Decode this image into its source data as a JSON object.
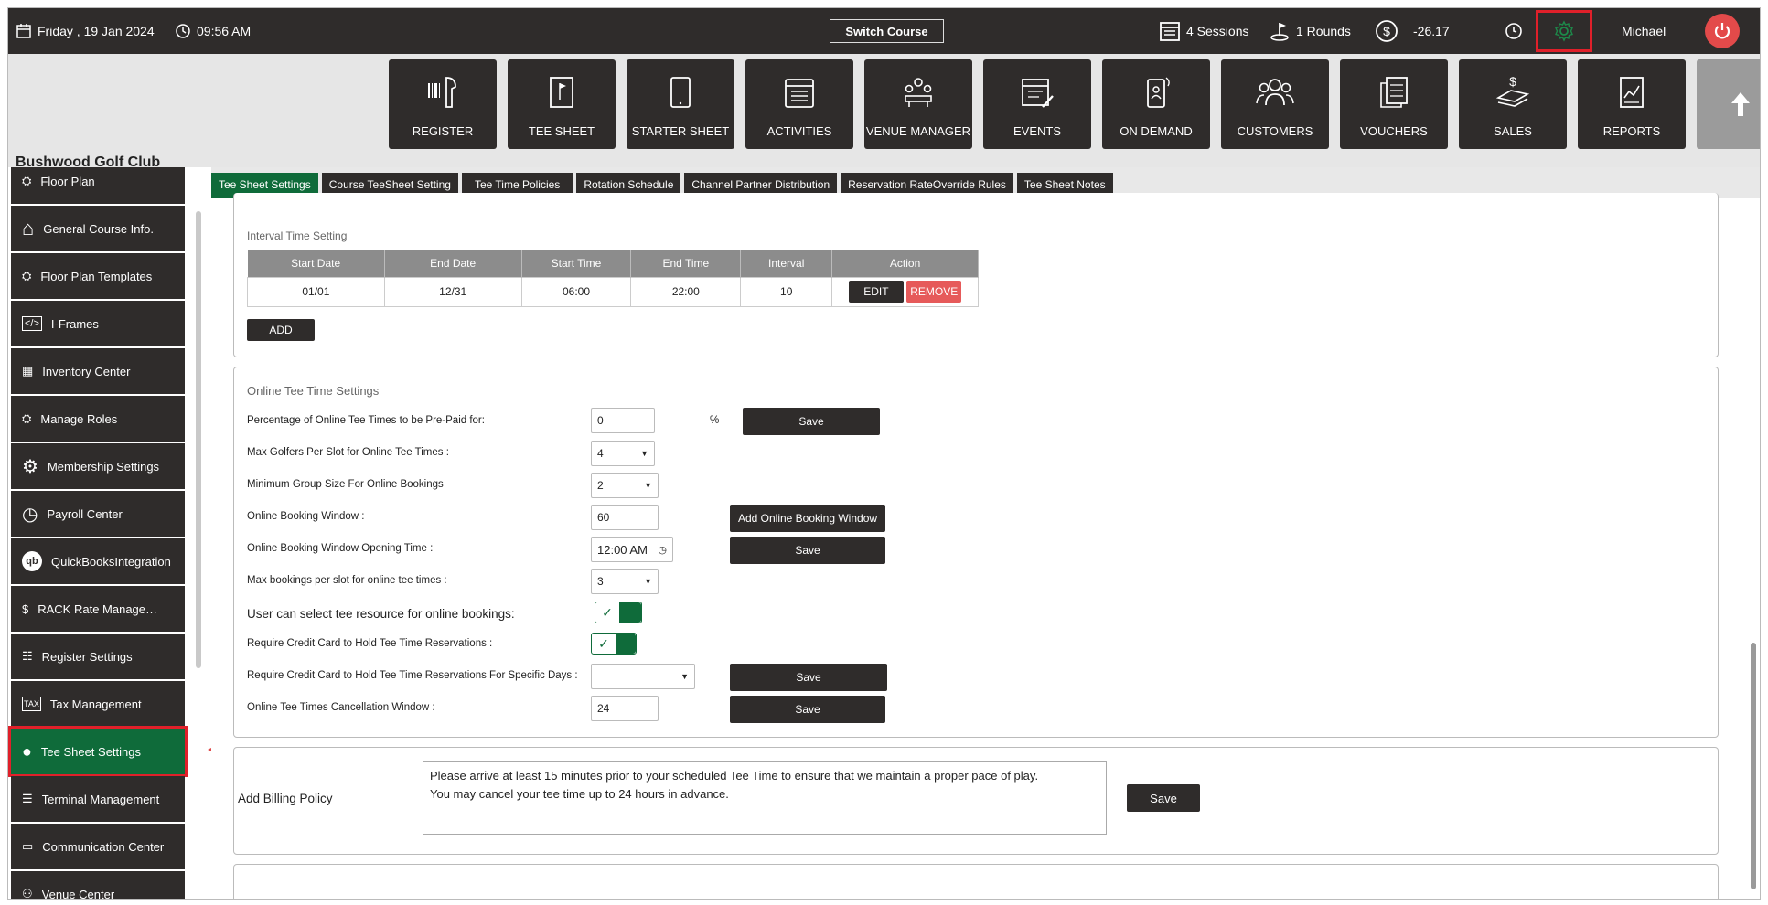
{
  "topbar": {
    "date": "Friday ,  19 Jan 2024",
    "time": "09:56 AM",
    "switch_course": "Switch Course",
    "sessions": "4 Sessions",
    "rounds": "1 Rounds",
    "balance": "-26.17",
    "user": "Michael"
  },
  "club_name": "Bushwood Golf Club",
  "modules": [
    {
      "label": "REGISTER",
      "icon": "barcode-scanner-icon"
    },
    {
      "label": "TEE SHEET",
      "icon": "flag-sheet-icon"
    },
    {
      "label": "STARTER SHEET",
      "icon": "tablet-icon"
    },
    {
      "label": "ACTIVITIES",
      "icon": "calendar-list-icon"
    },
    {
      "label": "VENUE MANAGER",
      "icon": "meeting-table-icon"
    },
    {
      "label": "EVENTS",
      "icon": "calendar-edit-icon"
    },
    {
      "label": "ON DEMAND",
      "icon": "mobile-person-icon"
    },
    {
      "label": "CUSTOMERS",
      "icon": "people-group-icon"
    },
    {
      "label": "VOUCHERS",
      "icon": "documents-icon"
    },
    {
      "label": "SALES",
      "icon": "money-stack-icon"
    },
    {
      "label": "REPORTS",
      "icon": "report-chart-icon"
    }
  ],
  "sidebar": [
    {
      "label": "Floor Plan",
      "icon": "floor-plan-icon"
    },
    {
      "label": "General Course Info.",
      "icon": "home-icon"
    },
    {
      "label": "Floor Plan Templates",
      "icon": "floor-plan-icon"
    },
    {
      "label": "I-Frames",
      "icon": "code-icon"
    },
    {
      "label": "Inventory Center",
      "icon": "inventory-icon"
    },
    {
      "label": "Manage Roles",
      "icon": "roles-icon"
    },
    {
      "label": "Membership Settings",
      "icon": "gear-icon"
    },
    {
      "label": "Payroll Center",
      "icon": "clock-icon"
    },
    {
      "label": "QuickBooksIntegration",
      "icon": "quickbooks-icon"
    },
    {
      "label": "RACK Rate Manageme...",
      "icon": "money-hand-icon"
    },
    {
      "label": "Register Settings",
      "icon": "sliders-icon"
    },
    {
      "label": "Tax Management",
      "icon": "tax-icon"
    },
    {
      "label": "Tee Sheet Settings",
      "icon": "golf-tee-icon"
    },
    {
      "label": "Terminal Management",
      "icon": "terminal-icon"
    },
    {
      "label": "Communication Center",
      "icon": "card-icon"
    },
    {
      "label": "Venue Center",
      "icon": "people-icon"
    }
  ],
  "tabs": [
    "Tee Sheet Settings",
    "Course TeeSheet Setting",
    "Tee Time Policies",
    "Rotation Schedule",
    "Channel Partner Distribution",
    "Reservation RateOverride Rules",
    "Tee Sheet Notes"
  ],
  "interval": {
    "title": "Interval Time Setting",
    "headers": [
      "Start Date",
      "End Date",
      "Start Time",
      "End Time",
      "Interval",
      "Action"
    ],
    "rows": [
      {
        "start_date": "01/01",
        "end_date": "12/31",
        "start_time": "06:00",
        "end_time": "22:00",
        "interval": "10"
      }
    ],
    "edit": "EDIT",
    "remove": "REMOVE",
    "add": "ADD"
  },
  "online": {
    "title": "Online Tee Time Settings",
    "prepaid_label": "Percentage of Online Tee Times to be Pre-Paid for:",
    "prepaid_value": "0",
    "percent": "%",
    "max_golfers_label": "Max Golfers Per Slot for Online Tee Times :",
    "max_golfers_value": "4",
    "min_group_label": "Minimum Group Size For Online Bookings",
    "min_group_value": "2",
    "window_label": "Online Booking Window :",
    "window_value": "60",
    "add_window": "Add Online Booking Window",
    "opening_label": "Online Booking Window Opening Time :",
    "opening_value": "12:00 AM",
    "max_bookings_label": "Max bookings per slot for online tee times :",
    "max_bookings_value": "3",
    "resource_label": "User can select tee resource for online bookings:",
    "credit_label": "Require Credit Card to Hold Tee Time Reservations :",
    "credit_days_label": "Require Credit Card to Hold Tee Time Reservations For Specific Days :",
    "credit_days_value": "",
    "cancel_label": "Online Tee Times Cancellation Window :",
    "cancel_value": "24",
    "save": "Save"
  },
  "billing": {
    "label": "Add Billing Policy",
    "text_line1": "Please arrive at least 15 minutes prior to your scheduled Tee Time to ensure that we maintain a proper pace of play.",
    "text_line2": "You may cancel your tee time up to 24 hours in advance.",
    "save": "Save"
  }
}
